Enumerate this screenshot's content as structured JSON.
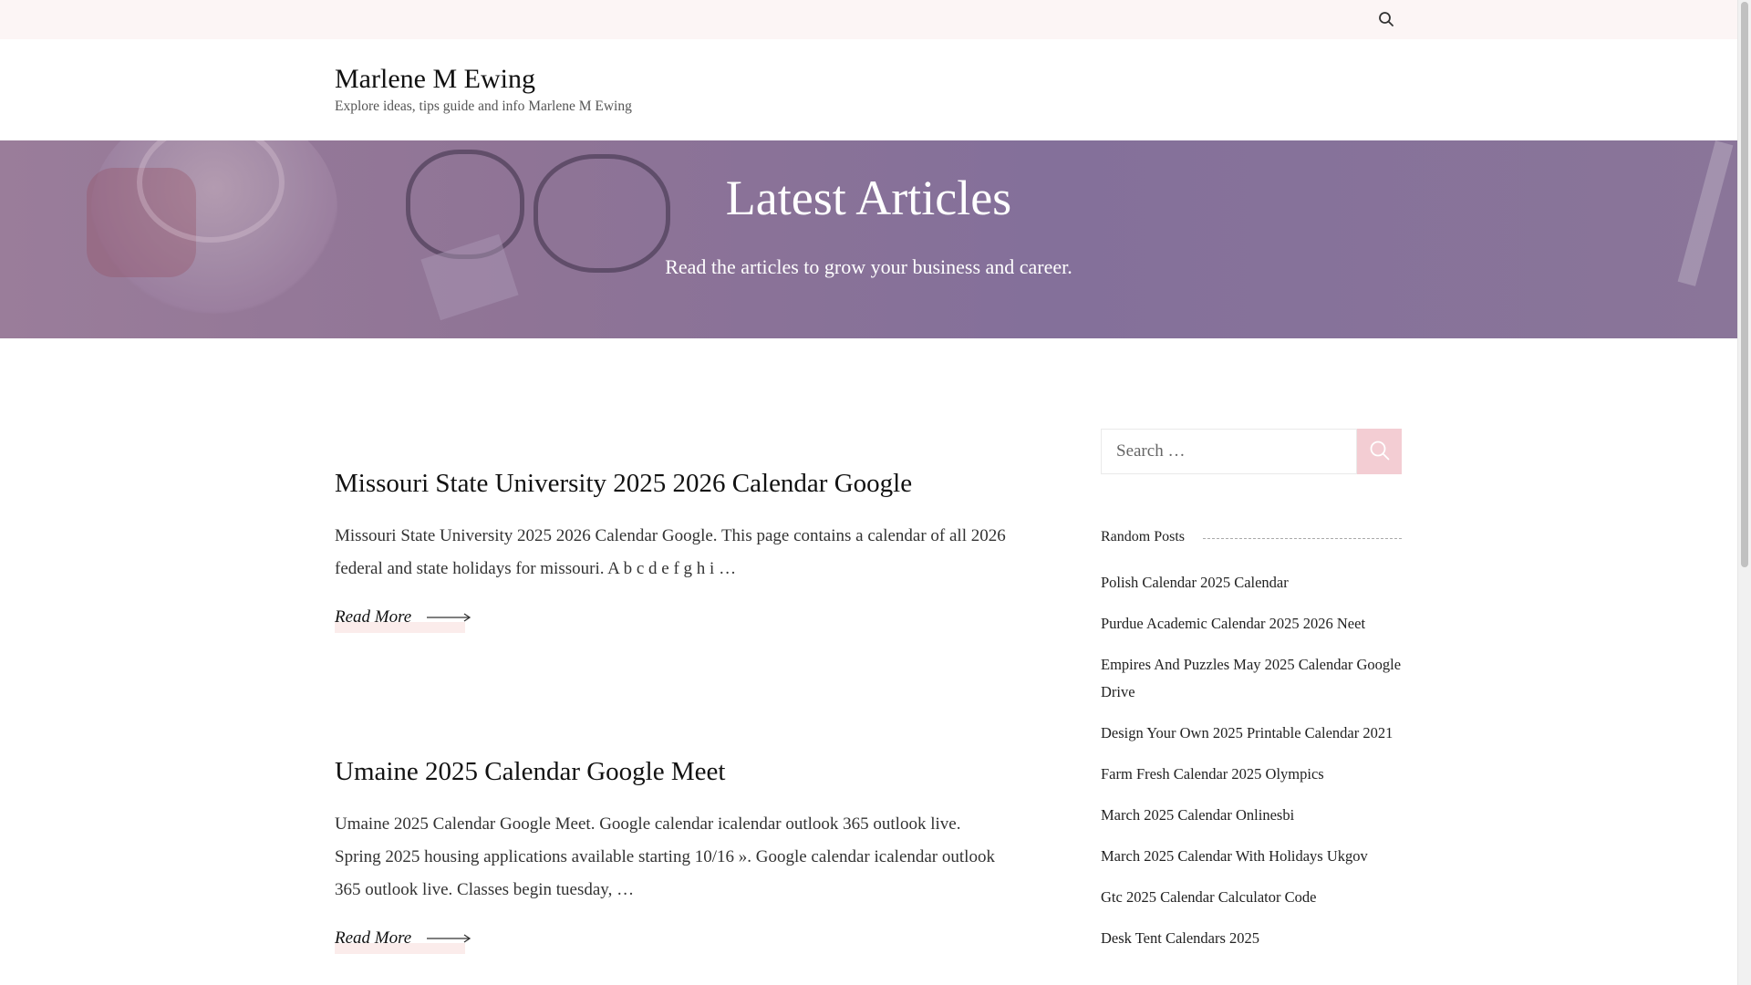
{
  "topbar": {
    "search_icon": "search-icon"
  },
  "site": {
    "title": "Marlene M Ewing",
    "description": "Explore ideas, tips guide and info Marlene M Ewing"
  },
  "hero": {
    "title": "Latest Articles",
    "subtitle": "Read the articles to grow your business and career."
  },
  "posts": [
    {
      "title": "Missouri State University 2025 2026 Calendar Google",
      "excerpt": "Missouri State University 2025 2026 Calendar Google. This page contains a calendar of all 2026 federal and state holidays for missouri. A b c d e f g h i …",
      "read_more": "Read More"
    },
    {
      "title": "Umaine 2025 Calendar Google Meet",
      "excerpt": "Umaine 2025 Calendar Google Meet. Google calendar icalendar outlook 365 outlook live. Spring 2025 housing applications available starting 10/16 ». Google calendar icalendar outlook 365 outlook live. Classes begin tuesday, …",
      "read_more": "Read More"
    }
  ],
  "sidebar": {
    "search_placeholder": "Search …",
    "random_posts_title": "Random Posts",
    "random_posts": [
      "Polish Calendar 2025 Calendar",
      "Purdue Academic Calendar 2025 2026 Neet",
      "Empires And Puzzles May 2025 Calendar Google Drive",
      "Design Your Own 2025 Printable Calendar 2021",
      "Farm Fresh Calendar 2025 Olympics",
      "March 2025 Calendar Onlinesbi",
      "March 2025 Calendar With Holidays Ukgov",
      "Gtc 2025 Calendar Calculator Code",
      "Desk Tent Calendars 2025"
    ]
  },
  "colors": {
    "topbar_bg": "#fcf5f5",
    "hero_overlay": "#84709a",
    "accent_pink": "#f3cdd3"
  }
}
